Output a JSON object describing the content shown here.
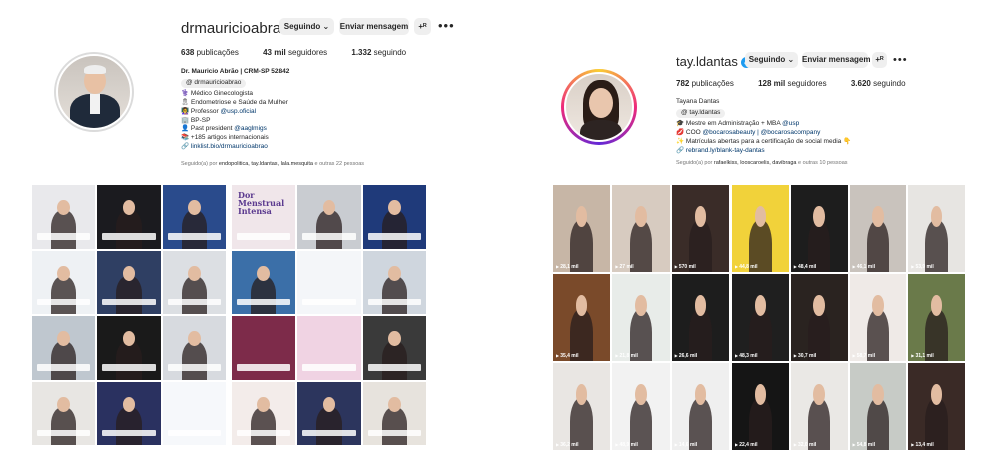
{
  "profiles": [
    {
      "username": "drmauricioabrao",
      "buttons": {
        "following": "Seguindo",
        "message": "Enviar mensagem",
        "add_user": "+ᴿ"
      },
      "stats": {
        "posts": "638",
        "posts_label": "publicações",
        "followers": "43 mil",
        "followers_label": "seguidores",
        "following": "1.332",
        "following_label": "seguindo"
      },
      "bio": {
        "name": "Dr. Mauricio Abrão | CRM-SP 52842",
        "threads": "drmauricioabrao",
        "lines": [
          "⚕️ Médico Ginecologista",
          "🎗 Endometriose e Saúde da Mulher",
          "👩‍🏫 Professor ",
          "🏢 BP-SP",
          "👤 Past president ",
          "📚 +185 artigos internacionais"
        ],
        "professor_mention": "@usp.oficial",
        "past_mention": "@aaglmigs",
        "link": "linklist.bio/drmauricioabrao"
      },
      "followed_by": {
        "prefix": "Seguido(a) por ",
        "names": "endopolitica, tay.ldantas, lala.mesquita",
        "suffix": " e outras 22 pessoas"
      },
      "tiles": [
        {
          "bg": "#e9e9ec",
          "style": "person"
        },
        {
          "bg": "#1b1b1f",
          "style": "person"
        },
        {
          "bg": "#2a4b8c",
          "style": "person"
        },
        {
          "bg": "#eef1f4",
          "style": "person"
        },
        {
          "bg": "#2f3f63",
          "style": "person"
        },
        {
          "bg": "#dcdfe3",
          "style": "person"
        },
        {
          "bg": "#f0e6ea",
          "style": "text",
          "text": "Dor\nMenstrual\nIntensa"
        },
        {
          "bg": "#c9ccd1",
          "style": "person"
        },
        {
          "bg": "#1f3a7a",
          "style": "person"
        },
        {
          "bg": "#bfc7cf",
          "style": "person"
        },
        {
          "bg": "#1a1a1a",
          "style": "person"
        },
        {
          "bg": "#d7dadf",
          "style": "person"
        },
        {
          "bg": "#3b6fa8",
          "style": "person"
        },
        {
          "bg": "#f4f6f9",
          "style": "plain"
        },
        {
          "bg": "#cfd6de",
          "style": "person"
        },
        {
          "bg": "#e8e6e3",
          "style": "person"
        },
        {
          "bg": "#2a3160",
          "style": "person"
        },
        {
          "bg": "#f6f8fb",
          "style": "plain"
        },
        {
          "bg": "#7d2b4a",
          "style": "plain"
        },
        {
          "bg": "#f0d3e3",
          "style": "plain"
        },
        {
          "bg": "#3a3a3a",
          "style": "person"
        },
        {
          "bg": "#f3ecea",
          "style": "person"
        },
        {
          "bg": "#2c355d",
          "style": "person"
        },
        {
          "bg": "#e7e3dd",
          "style": "person"
        },
        {
          "bg": "#c3c7cc",
          "style": "person"
        }
      ]
    },
    {
      "username": "tay.ldantas",
      "buttons": {
        "following": "Seguindo",
        "message": "Enviar mensagem",
        "add_user": "+ᴿ"
      },
      "stats": {
        "posts": "782",
        "posts_label": "publicações",
        "followers": "128 mil",
        "followers_label": "seguidores",
        "following": "3.620",
        "following_label": "seguindo"
      },
      "bio": {
        "name": "Tayana Dantas",
        "threads": "tay.ldantas",
        "lines": [
          "🎓 Mestre em Administração + MBA ",
          "💋 COO ",
          "✨ Matrículas abertas para a certificação de social media 👇"
        ],
        "mba_mention": "@usp",
        "coo_mention": "@bocarosabeauty | @bocarosacompany",
        "link": "rebrand.ly/blank-tay-dantas"
      },
      "followed_by": {
        "prefix": "Seguido(a) por ",
        "names": "rafaelkiss, looscaroelis, davibraga",
        "suffix": " e outras 10 pessoas"
      },
      "tiles": [
        {
          "bg": "#c7b6a6",
          "views": "28,1 mil"
        },
        {
          "bg": "#d7cbc0",
          "views": "27 mil"
        },
        {
          "bg": "#3a2c28",
          "views": "570 mil"
        },
        {
          "bg": "#f1d23a",
          "views": "44,8 mil"
        },
        {
          "bg": "#1d1d1d",
          "views": "48,4 mil"
        },
        {
          "bg": "#c9c3bd",
          "views": "46,1 mil"
        },
        {
          "bg": "#e7e5e2",
          "views": "53,9 mil"
        },
        {
          "bg": "#7a4a2a",
          "views": "35,4 mil"
        },
        {
          "bg": "#e8ece9",
          "views": "21,8 mil"
        },
        {
          "bg": "#1d1d1d",
          "views": "26,6 mil"
        },
        {
          "bg": "#1f1f1f",
          "views": "48,3 mil"
        },
        {
          "bg": "#2a2320",
          "views": "30,7 mil"
        },
        {
          "bg": "#efeae7",
          "views": "58,7 mil"
        },
        {
          "bg": "#6a7a4a",
          "views": "31,1 mil"
        },
        {
          "bg": "#e9e6e3",
          "views": "36,2 mil"
        },
        {
          "bg": "#f2f2f2",
          "views": "48,9 mil"
        },
        {
          "bg": "#efefef",
          "views": "14,6 mil"
        },
        {
          "bg": "#151515",
          "views": "22,4 mil"
        },
        {
          "bg": "#eae8e5",
          "views": "32,0 mil"
        },
        {
          "bg": "#c7cbc6",
          "views": "54,8 mil"
        },
        {
          "bg": "#3a2a26",
          "views": "13,4 mil"
        }
      ]
    }
  ]
}
